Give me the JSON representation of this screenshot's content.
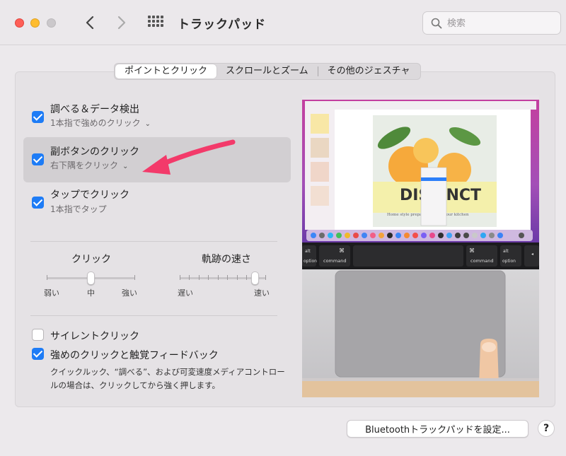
{
  "window": {
    "title": "トラックパッド"
  },
  "search": {
    "placeholder": "検索"
  },
  "tabs": [
    {
      "label": "ポイントとクリック",
      "active": true
    },
    {
      "label": "スクロールとズーム",
      "active": false
    },
    {
      "label": "その他のジェスチャ",
      "active": false
    }
  ],
  "options": [
    {
      "label": "調べる＆データ検出",
      "sub": "1本指で強めのクリック",
      "checked": true
    },
    {
      "label": "副ボタンのクリック",
      "sub": "右下隅をクリック",
      "checked": true
    },
    {
      "label": "タップでクリック",
      "sub": "1本指でタップ",
      "checked": true
    }
  ],
  "sliders": {
    "click": {
      "title": "クリック",
      "labels": [
        "弱い",
        "中",
        "強い"
      ],
      "value": "中"
    },
    "tracking": {
      "title": "軌跡の速さ",
      "labels": [
        "遅い",
        "速い"
      ],
      "value_fraction": 0.9
    }
  },
  "checks": {
    "silent": {
      "label": "サイレントクリック",
      "checked": false
    },
    "force": {
      "label": "強めのクリックと触覚フィードバック",
      "checked": true,
      "desc": "クイックルック、“調べる”、および可変速度メディアコントロールの場合は、クリックしてから強く押します。"
    }
  },
  "preview": {
    "keys_left": [
      "alt",
      "option"
    ],
    "keys_cmd": [
      "⌘",
      "command"
    ],
    "poster_text": "DISTINCT",
    "poster_sub": "Home style preparations for your kitchen"
  },
  "footer": {
    "bt_button": "Bluetoothトラックパッドを設定...",
    "help": "?"
  },
  "colors": {
    "accent": "#1e7cf6",
    "arrow": "#f33a6a"
  }
}
